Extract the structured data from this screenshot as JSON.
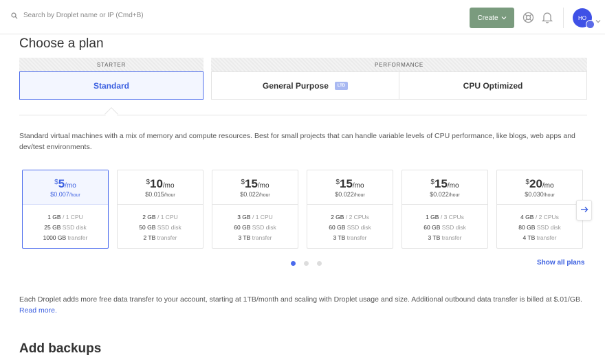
{
  "header": {
    "search_placeholder": "Search by Droplet name or IP (Cmd+B)",
    "create_label": "Create",
    "avatar_initials": "HO"
  },
  "page_title": "Choose a plan",
  "plan_tabs": {
    "starter_label": "STARTER",
    "performance_label": "PERFORMANCE",
    "standard": "Standard",
    "general_purpose": "General Purpose",
    "ltd_badge": "LTD",
    "cpu_optimized": "CPU Optimized"
  },
  "plan_description": "Standard virtual machines with a mix of memory and compute resources. Best for small projects that can handle variable levels of CPU performance, like blogs, web apps and dev/test environments.",
  "plans": [
    {
      "currency": "$",
      "price": "5",
      "per": "/mo",
      "hourly": "$0.007",
      "hourly_unit": "/hour",
      "memory": "1 GB",
      "cpu": "1 CPU",
      "disk": "25 GB",
      "disk_unit": "SSD disk",
      "transfer": "1000 GB",
      "transfer_unit": "transfer"
    },
    {
      "currency": "$",
      "price": "10",
      "per": "/mo",
      "hourly": "$0.015",
      "hourly_unit": "/hour",
      "memory": "2 GB",
      "cpu": "1 CPU",
      "disk": "50 GB",
      "disk_unit": "SSD disk",
      "transfer": "2 TB",
      "transfer_unit": "transfer"
    },
    {
      "currency": "$",
      "price": "15",
      "per": "/mo",
      "hourly": "$0.022",
      "hourly_unit": "/hour",
      "memory": "3 GB",
      "cpu": "1 CPU",
      "disk": "60 GB",
      "disk_unit": "SSD disk",
      "transfer": "3 TB",
      "transfer_unit": "transfer"
    },
    {
      "currency": "$",
      "price": "15",
      "per": "/mo",
      "hourly": "$0.022",
      "hourly_unit": "/hour",
      "memory": "2 GB",
      "cpu": "2 CPUs",
      "disk": "60 GB",
      "disk_unit": "SSD disk",
      "transfer": "3 TB",
      "transfer_unit": "transfer"
    },
    {
      "currency": "$",
      "price": "15",
      "per": "/mo",
      "hourly": "$0.022",
      "hourly_unit": "/hour",
      "memory": "1 GB",
      "cpu": "3 CPUs",
      "disk": "60 GB",
      "disk_unit": "SSD disk",
      "transfer": "3 TB",
      "transfer_unit": "transfer"
    },
    {
      "currency": "$",
      "price": "20",
      "per": "/mo",
      "hourly": "$0.030",
      "hourly_unit": "/hour",
      "memory": "4 GB",
      "cpu": "2 CPUs",
      "disk": "80 GB",
      "disk_unit": "SSD disk",
      "transfer": "4 TB",
      "transfer_unit": "transfer"
    }
  ],
  "show_all_plans": "Show all plans",
  "transfer_note": "Each Droplet adds more free data transfer to your account, starting at 1TB/month and scaling with Droplet usage and size. Additional outbound data transfer is billed at $.01/GB.",
  "read_more": "Read more.",
  "backups_title": "Add backups",
  "colors": {
    "accent": "#4b6bed",
    "create_button": "#7a9b7e"
  }
}
